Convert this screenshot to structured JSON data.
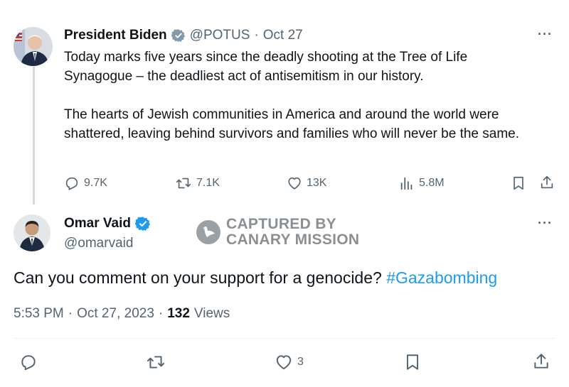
{
  "original_tweet": {
    "author_name": "President Biden",
    "handle": "@POTUS",
    "separator": "·",
    "date": "Oct 27",
    "paragraph1": "Today marks five years since the deadly shooting at the Tree of Life Synagogue – the deadliest act of antisemitism in our history.",
    "paragraph2": "The hearts of Jewish communities in America and around the world were shattered, leaving behind survivors and families who will never be the same.",
    "replies": "9.7K",
    "reposts": "7.1K",
    "likes": "13K",
    "views": "5.8M"
  },
  "reply_tweet": {
    "author_name": "Omar Vaid",
    "handle": "@omarvaid",
    "text": "Can you comment on your support for a genocide?",
    "hashtag": "#Gazabombing",
    "time": "5:53 PM",
    "date_sep": "·",
    "date": "Oct 27, 2023",
    "views_sep": "·",
    "views_count": "132",
    "views_label": "Views",
    "likes": "3"
  },
  "watermark": {
    "line1": "CAPTURED BY",
    "line2": "CANARY MISSION"
  },
  "more_label": "···",
  "colors": {
    "verified_gray": "#829aab",
    "verified_blue": "#1d9bf0",
    "hashtag": "#1d9bf0",
    "muted_text": "#536471",
    "watermark": "#8a8f93"
  }
}
